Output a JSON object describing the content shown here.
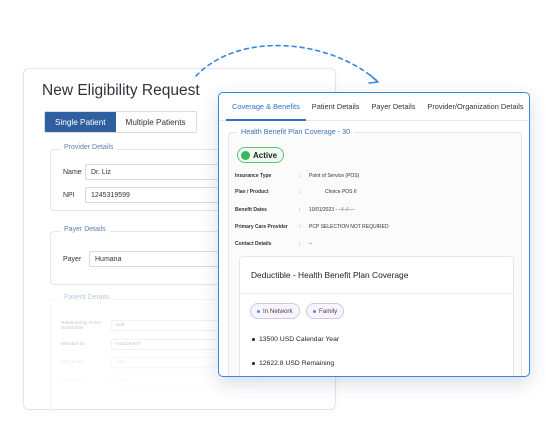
{
  "request": {
    "title": "New Eligibility Request",
    "tabs": [
      "Single Patient",
      "Multiple Patients"
    ],
    "provider_section": "Provider Details",
    "provider_name_label": "Name",
    "provider_name_value": "Dr. Liz",
    "provider_npi_label": "NPI",
    "provider_npi_value": "1245319599",
    "payer_section": "Payer Details",
    "payer_label": "Payer",
    "payer_value": "Humana",
    "patient_section": "Patient Details",
    "patient_rows": [
      {
        "label": "Relationship to the Subscriber",
        "value": "Self"
      },
      {
        "label": "Member ID",
        "value": "H52345678"
      },
      {
        "label": "First Name",
        "value": "John"
      },
      {
        "label": "Last Name",
        "value": "Doe"
      }
    ]
  },
  "coverage": {
    "tabs": [
      "Coverage & Benefits",
      "Patient Details",
      "Payer Details",
      "Provider/Organization Details"
    ],
    "plan_legend": "Health Benefit Plan Coverage - 30",
    "status": "Active",
    "info": [
      {
        "key": "Insurance Type",
        "value": "Point of Service (POS)"
      },
      {
        "key": "Plan / Product",
        "value": "Choice POS II"
      },
      {
        "key": "Benefit Dates",
        "value": "10/01/2023 - --/--/----"
      },
      {
        "key": "Primary Care Provider",
        "value": "PCP SELECTION NOT REQUIRED"
      },
      {
        "key": "Contact Details",
        "value": "--"
      }
    ],
    "deductible_title": "Deductible - Health Benefit Plan Coverage",
    "chips": [
      "In Network",
      "Family"
    ],
    "bullets": [
      "13500 USD Calendar Year",
      "12622.8 USD Remaining"
    ]
  },
  "colors": {
    "accent": "#3a86e0",
    "tab_active": "#2f5f9e",
    "active_status": "#39b65a"
  }
}
